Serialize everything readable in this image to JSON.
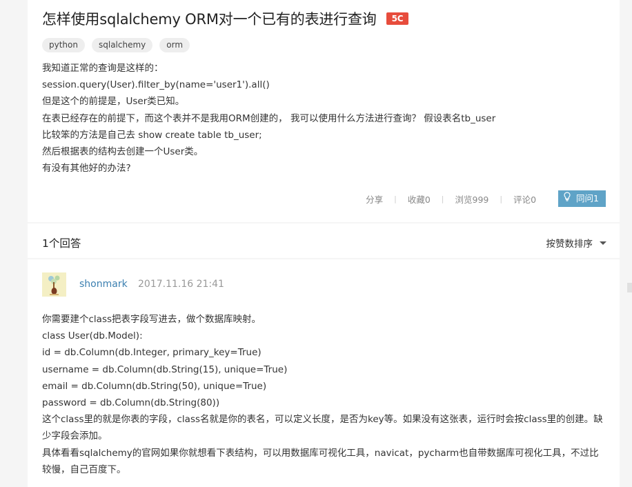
{
  "question": {
    "title": "怎样使用sqlalchemy ORM对一个已有的表进行查询",
    "badge": "5C",
    "tags": [
      "python",
      "sqlalchemy",
      "orm"
    ],
    "body_lines": [
      "我知道正常的查询是这样的：",
      "session.query(User).filter_by(name='user1').all()",
      "但是这个的前提是，User类已知。",
      "在表已经存在的前提下，而这个表并不是我用ORM创建的， 我可以使用什么方法进行查询？ 假设表名tb_user",
      "比较笨的方法是自己去 show create table tb_user;",
      "然后根据表的结构去创建一个User类。",
      "有没有其他好的办法?"
    ],
    "actions": {
      "share": "分享",
      "favorite": "收藏0",
      "views": "浏览999",
      "comments": "评论0",
      "same_question": "同问1"
    }
  },
  "answers_header": {
    "count": "1个回答",
    "sort": "按赞数排序"
  },
  "answer": {
    "username": "shonmark",
    "time": "2017.11.16 21:41",
    "body_lines": [
      "你需要建个class把表字段写进去，做个数据库映射。",
      "class User(db.Model):",
      "id = db.Column(db.Integer, primary_key=True)",
      "username = db.Column(db.String(15), unique=True)",
      "email = db.Column(db.String(50), unique=True)",
      "password = db.Column(db.String(80))",
      "这个class里的就是你表的字段，class名就是你的表名，可以定义长度，是否为key等。如果没有这张表，运行时会按class里的创建。缺少字段会添加。",
      "具体看看sqlalchemy的官网如果你就想看下表结构，可以用数据库可视化工具，navicat，pycharm也自带数据库可视化工具，不过比较慢，自己百度下。"
    ]
  },
  "colors": {
    "badge": "#e74c3c",
    "same_button": "#5fa3c7",
    "username": "#3b7fb0"
  }
}
